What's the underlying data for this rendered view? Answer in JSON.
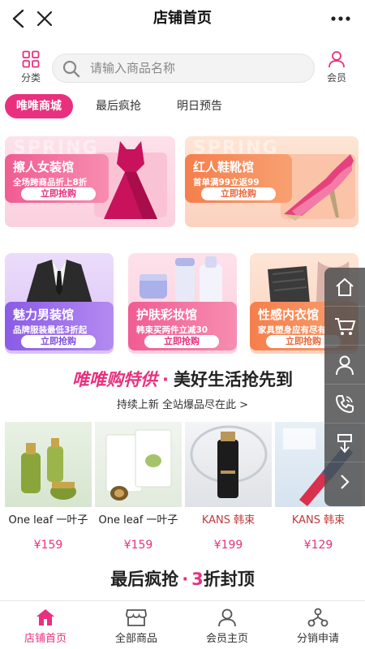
{
  "header": {
    "title": "店铺首页"
  },
  "search": {
    "placeholder": "请输入商品名称",
    "category_label": "分类",
    "member_label": "会员"
  },
  "tabs": [
    {
      "label": "唯唯商城"
    },
    {
      "label": "最后疯抢"
    },
    {
      "label": "明日预告"
    }
  ],
  "banners": [
    {
      "title": "擦人女装馆",
      "subtitle": "全场跨商品折上8折",
      "button": "立即抢购",
      "deco": "SPRING"
    },
    {
      "title": "红人鞋靴馆",
      "subtitle": "首单满99立返99",
      "button": "立即抢购",
      "deco": "SPRING"
    },
    {
      "title": "魅力男装馆",
      "subtitle": "品牌服装最低3折起",
      "button": "立即抢购"
    },
    {
      "title": "护肤彩妆馆",
      "subtitle": "韩束买两件立减30",
      "button": "立即抢购"
    },
    {
      "title": "性感内衣馆",
      "subtitle": "家具塑身应有尽有",
      "button": "立即抢购"
    }
  ],
  "promo": {
    "title_left": "唯唯购特供",
    "dot": "·",
    "title_right": "美好生活抢先到",
    "subtitle": "持续上新 全站爆品尽在此 >"
  },
  "products": [
    {
      "brand": "One leaf 一叶子",
      "price": "¥159"
    },
    {
      "brand": "One leaf 一叶子",
      "price": "¥159"
    },
    {
      "brand": "KANS 韩束",
      "price": "¥199"
    },
    {
      "brand": "KANS 韩束",
      "price": "¥129"
    }
  ],
  "section2": {
    "left": "最后疯抢",
    "dot": "·",
    "right_num": "3",
    "right_text": "折封顶"
  },
  "bottom_nav": [
    {
      "label": "店铺首页"
    },
    {
      "label": "全部商品"
    },
    {
      "label": "会员主页"
    },
    {
      "label": "分销申请"
    }
  ],
  "colors": {
    "accent": "#e9307e",
    "orange": "#f57f4c",
    "purple": "#8a5be6"
  }
}
